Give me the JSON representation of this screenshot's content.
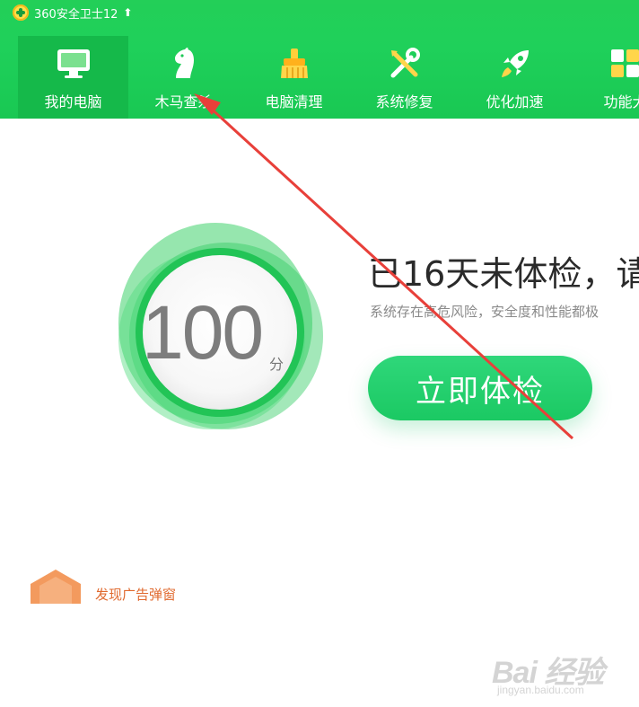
{
  "app": {
    "title": "360安全卫士12",
    "update_glyph": "⬆"
  },
  "nav": {
    "items": [
      {
        "label": "我的电脑",
        "icon": "monitor-icon",
        "active": true
      },
      {
        "label": "木马查杀",
        "icon": "horse-icon",
        "active": false
      },
      {
        "label": "电脑清理",
        "icon": "broom-icon",
        "active": false
      },
      {
        "label": "系统修复",
        "icon": "tools-icon",
        "active": false
      },
      {
        "label": "优化加速",
        "icon": "rocket-icon",
        "active": false
      },
      {
        "label": "功能大",
        "icon": "grid-icon",
        "active": false
      }
    ]
  },
  "main": {
    "score": "100",
    "score_unit": "分",
    "headline": "已16天未体检，请",
    "subline": "系统存在高危风险，安全度和性能都极",
    "check_button": "立即体检",
    "ad_text": "发现广告弹窗"
  },
  "watermark": {
    "main": "Bai 经验",
    "sub": "jingyan.baidu.com"
  },
  "colors": {
    "header_green": "#1fd05a",
    "active_tab": "#15b94a",
    "button_green": "#1bc963",
    "arrow_red": "#e8403a",
    "ad_orange": "#e06a2f"
  }
}
